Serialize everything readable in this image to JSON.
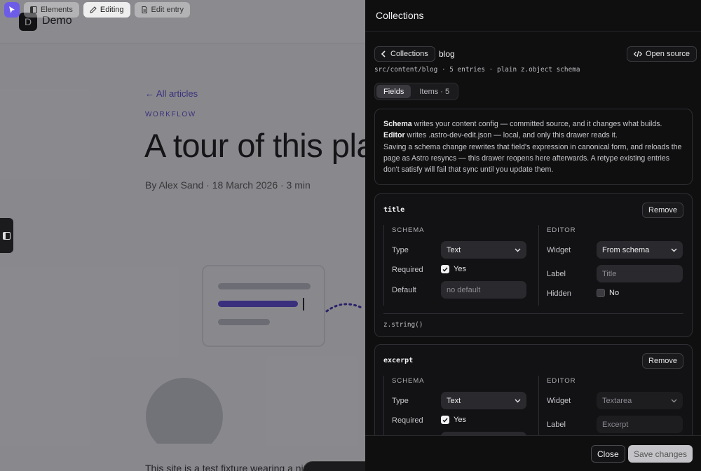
{
  "toolbar": {
    "items": [
      {
        "label": "Elements",
        "icon": "panel-icon"
      },
      {
        "label": "Editing",
        "icon": "pencil-icon"
      },
      {
        "label": "Edit entry",
        "icon": "document-icon"
      }
    ]
  },
  "site": {
    "logo_letter": "D",
    "name": "Demo"
  },
  "article": {
    "back_link": "← All articles",
    "kicker": "WORKFLOW",
    "title": "A tour of this pla",
    "byline": "By Alex Sand · 18 March 2026 · 3 min",
    "body_snippet": "This site is a test fixture wearing a nice c"
  },
  "drawer": {
    "title": "Collections",
    "crumb_back": "Collections",
    "crumb_current": "blog",
    "open_source": "Open source",
    "meta": "src/content/blog · 5 entries · plain z.object schema",
    "tabs": [
      {
        "label": "Fields",
        "active": true
      },
      {
        "label": "Items · 5",
        "active": false
      }
    ],
    "info": {
      "schema_term": "Schema",
      "schema_text": " writes your content config — committed source, and it changes what builds.",
      "editor_term": "Editor",
      "editor_text": " writes .astro-dev-edit.json — local, and only this drawer reads it.",
      "note": "Saving a schema change rewrites that field's expression in canonical form, and reloads the page as Astro resyncs — this drawer reopens here afterwards. A retype existing entries don't satisfy will fail that sync until you update them."
    },
    "labels": {
      "schema": "SCHEMA",
      "editor": "EDITOR",
      "type": "Type",
      "required": "Required",
      "default": "Default",
      "widget": "Widget",
      "label": "Label",
      "hidden": "Hidden",
      "remove": "Remove"
    },
    "fields": [
      {
        "name": "title",
        "type": "Text",
        "required": "Yes",
        "default_placeholder": "no default",
        "widget": "From schema",
        "label_placeholder": "Title",
        "hidden": "No",
        "expression": "z.string()"
      },
      {
        "name": "excerpt",
        "type": "Text",
        "required": "Yes",
        "widget": "Textarea",
        "label_placeholder": "Excerpt"
      }
    ],
    "footer": {
      "close": "Close",
      "save": "Save changes"
    }
  },
  "colors": {
    "accent": "#5b48d6",
    "toolbar_home": "#6c5ce7",
    "drawer_bg": "#0f0f10"
  }
}
